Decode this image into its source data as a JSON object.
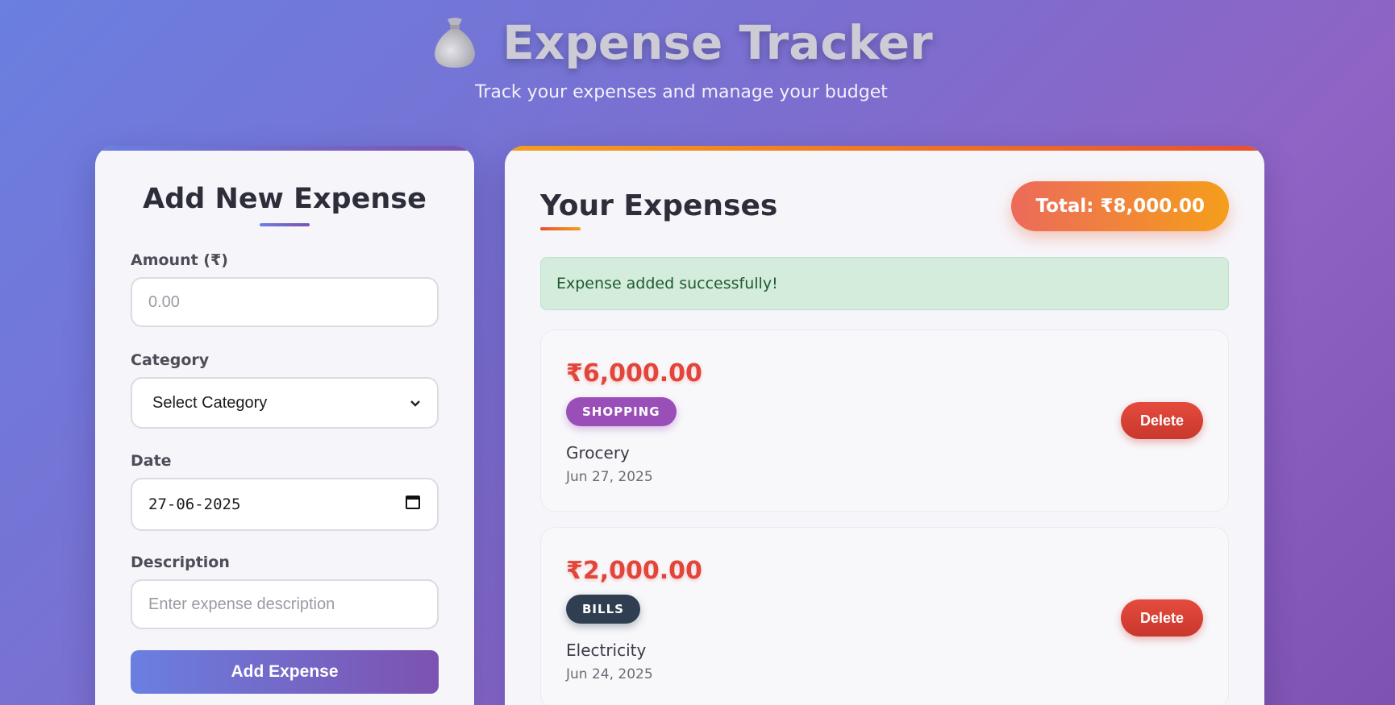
{
  "header": {
    "title": "Expense Tracker",
    "subtitle": "Track your expenses and manage your budget",
    "icon": "money-bag-icon"
  },
  "form": {
    "title": "Add New Expense",
    "amount": {
      "label": "Amount (₹)",
      "value": "",
      "placeholder": "0.00"
    },
    "category": {
      "label": "Category",
      "selected": "Select Category"
    },
    "date": {
      "label": "Date",
      "value": "27-06-2025"
    },
    "description": {
      "label": "Description",
      "value": "",
      "placeholder": "Enter expense description"
    },
    "submit_label": "Add Expense"
  },
  "list": {
    "title": "Your Expenses",
    "total_label": "Total: ₹8,000.00",
    "alert": "Expense added successfully!",
    "delete_label": "Delete",
    "items": [
      {
        "amount": "₹6,000.00",
        "category": "SHOPPING",
        "description": "Grocery",
        "date": "Jun 27, 2025",
        "category_color": "#9a4fb8"
      },
      {
        "amount": "₹2,000.00",
        "category": "BILLS",
        "description": "Electricity",
        "date": "Jun 24, 2025",
        "category_color": "#2f3e50"
      }
    ]
  },
  "colors": {
    "accent_gradient": [
      "#6a7fe0",
      "#7d52b0"
    ],
    "total_gradient": [
      "#ec6a5a",
      "#f59e1b"
    ],
    "amount": "#e2453a",
    "delete": "#d63f33",
    "success_bg": "#d3ecdc"
  }
}
